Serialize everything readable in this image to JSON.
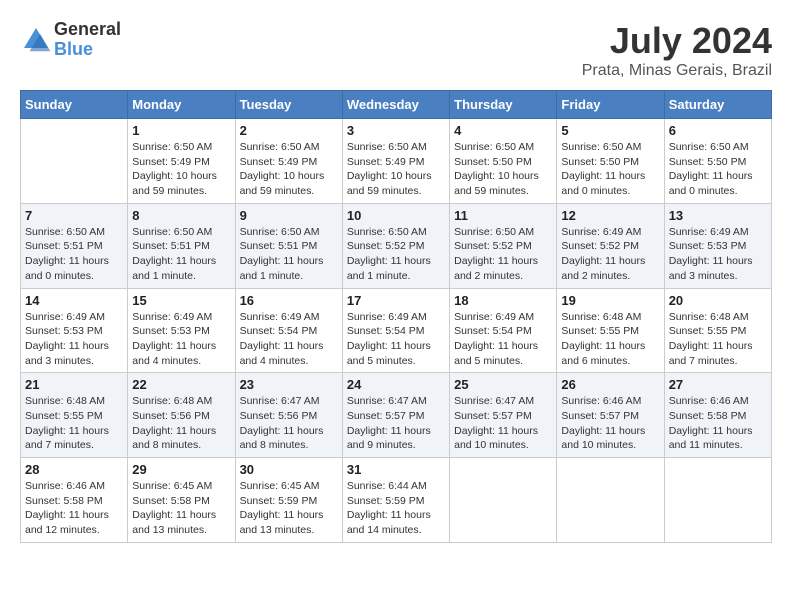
{
  "header": {
    "logo_general": "General",
    "logo_blue": "Blue",
    "month_year": "July 2024",
    "location": "Prata, Minas Gerais, Brazil"
  },
  "days_of_week": [
    "Sunday",
    "Monday",
    "Tuesday",
    "Wednesday",
    "Thursday",
    "Friday",
    "Saturday"
  ],
  "weeks": [
    [
      {
        "day": "",
        "info": ""
      },
      {
        "day": "1",
        "info": "Sunrise: 6:50 AM\nSunset: 5:49 PM\nDaylight: 10 hours\nand 59 minutes."
      },
      {
        "day": "2",
        "info": "Sunrise: 6:50 AM\nSunset: 5:49 PM\nDaylight: 10 hours\nand 59 minutes."
      },
      {
        "day": "3",
        "info": "Sunrise: 6:50 AM\nSunset: 5:49 PM\nDaylight: 10 hours\nand 59 minutes."
      },
      {
        "day": "4",
        "info": "Sunrise: 6:50 AM\nSunset: 5:50 PM\nDaylight: 10 hours\nand 59 minutes."
      },
      {
        "day": "5",
        "info": "Sunrise: 6:50 AM\nSunset: 5:50 PM\nDaylight: 11 hours\nand 0 minutes."
      },
      {
        "day": "6",
        "info": "Sunrise: 6:50 AM\nSunset: 5:50 PM\nDaylight: 11 hours\nand 0 minutes."
      }
    ],
    [
      {
        "day": "7",
        "info": "Sunrise: 6:50 AM\nSunset: 5:51 PM\nDaylight: 11 hours\nand 0 minutes."
      },
      {
        "day": "8",
        "info": "Sunrise: 6:50 AM\nSunset: 5:51 PM\nDaylight: 11 hours\nand 1 minute."
      },
      {
        "day": "9",
        "info": "Sunrise: 6:50 AM\nSunset: 5:51 PM\nDaylight: 11 hours\nand 1 minute."
      },
      {
        "day": "10",
        "info": "Sunrise: 6:50 AM\nSunset: 5:52 PM\nDaylight: 11 hours\nand 1 minute."
      },
      {
        "day": "11",
        "info": "Sunrise: 6:50 AM\nSunset: 5:52 PM\nDaylight: 11 hours\nand 2 minutes."
      },
      {
        "day": "12",
        "info": "Sunrise: 6:49 AM\nSunset: 5:52 PM\nDaylight: 11 hours\nand 2 minutes."
      },
      {
        "day": "13",
        "info": "Sunrise: 6:49 AM\nSunset: 5:53 PM\nDaylight: 11 hours\nand 3 minutes."
      }
    ],
    [
      {
        "day": "14",
        "info": "Sunrise: 6:49 AM\nSunset: 5:53 PM\nDaylight: 11 hours\nand 3 minutes."
      },
      {
        "day": "15",
        "info": "Sunrise: 6:49 AM\nSunset: 5:53 PM\nDaylight: 11 hours\nand 4 minutes."
      },
      {
        "day": "16",
        "info": "Sunrise: 6:49 AM\nSunset: 5:54 PM\nDaylight: 11 hours\nand 4 minutes."
      },
      {
        "day": "17",
        "info": "Sunrise: 6:49 AM\nSunset: 5:54 PM\nDaylight: 11 hours\nand 5 minutes."
      },
      {
        "day": "18",
        "info": "Sunrise: 6:49 AM\nSunset: 5:54 PM\nDaylight: 11 hours\nand 5 minutes."
      },
      {
        "day": "19",
        "info": "Sunrise: 6:48 AM\nSunset: 5:55 PM\nDaylight: 11 hours\nand 6 minutes."
      },
      {
        "day": "20",
        "info": "Sunrise: 6:48 AM\nSunset: 5:55 PM\nDaylight: 11 hours\nand 7 minutes."
      }
    ],
    [
      {
        "day": "21",
        "info": "Sunrise: 6:48 AM\nSunset: 5:55 PM\nDaylight: 11 hours\nand 7 minutes."
      },
      {
        "day": "22",
        "info": "Sunrise: 6:48 AM\nSunset: 5:56 PM\nDaylight: 11 hours\nand 8 minutes."
      },
      {
        "day": "23",
        "info": "Sunrise: 6:47 AM\nSunset: 5:56 PM\nDaylight: 11 hours\nand 8 minutes."
      },
      {
        "day": "24",
        "info": "Sunrise: 6:47 AM\nSunset: 5:57 PM\nDaylight: 11 hours\nand 9 minutes."
      },
      {
        "day": "25",
        "info": "Sunrise: 6:47 AM\nSunset: 5:57 PM\nDaylight: 11 hours\nand 10 minutes."
      },
      {
        "day": "26",
        "info": "Sunrise: 6:46 AM\nSunset: 5:57 PM\nDaylight: 11 hours\nand 10 minutes."
      },
      {
        "day": "27",
        "info": "Sunrise: 6:46 AM\nSunset: 5:58 PM\nDaylight: 11 hours\nand 11 minutes."
      }
    ],
    [
      {
        "day": "28",
        "info": "Sunrise: 6:46 AM\nSunset: 5:58 PM\nDaylight: 11 hours\nand 12 minutes."
      },
      {
        "day": "29",
        "info": "Sunrise: 6:45 AM\nSunset: 5:58 PM\nDaylight: 11 hours\nand 13 minutes."
      },
      {
        "day": "30",
        "info": "Sunrise: 6:45 AM\nSunset: 5:59 PM\nDaylight: 11 hours\nand 13 minutes."
      },
      {
        "day": "31",
        "info": "Sunrise: 6:44 AM\nSunset: 5:59 PM\nDaylight: 11 hours\nand 14 minutes."
      },
      {
        "day": "",
        "info": ""
      },
      {
        "day": "",
        "info": ""
      },
      {
        "day": "",
        "info": ""
      }
    ]
  ]
}
